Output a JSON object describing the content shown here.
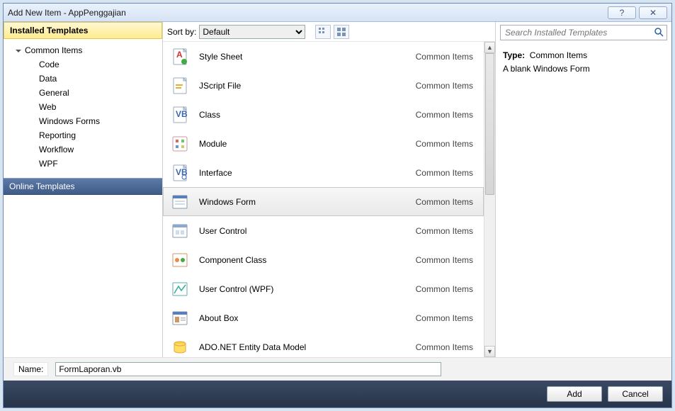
{
  "window": {
    "title": "Add New Item - AppPenggajian"
  },
  "sidebar": {
    "installed_header": "Installed Templates",
    "root": "Common Items",
    "children": [
      "Code",
      "Data",
      "General",
      "Web",
      "Windows Forms",
      "Reporting",
      "Workflow",
      "WPF"
    ],
    "online_header": "Online Templates"
  },
  "toolbar": {
    "sort_label": "Sort by:",
    "sort_value": "Default"
  },
  "items": [
    {
      "name": "Style Sheet",
      "cat": "Common Items",
      "icon": "stylesheet",
      "selected": false
    },
    {
      "name": "JScript File",
      "cat": "Common Items",
      "icon": "jscript",
      "selected": false
    },
    {
      "name": "Class",
      "cat": "Common Items",
      "icon": "class",
      "selected": false
    },
    {
      "name": "Module",
      "cat": "Common Items",
      "icon": "module",
      "selected": false
    },
    {
      "name": "Interface",
      "cat": "Common Items",
      "icon": "interface",
      "selected": false
    },
    {
      "name": "Windows Form",
      "cat": "Common Items",
      "icon": "form",
      "selected": true
    },
    {
      "name": "User Control",
      "cat": "Common Items",
      "icon": "usercontrol",
      "selected": false
    },
    {
      "name": "Component Class",
      "cat": "Common Items",
      "icon": "component",
      "selected": false
    },
    {
      "name": "User Control (WPF)",
      "cat": "Common Items",
      "icon": "wpfuc",
      "selected": false
    },
    {
      "name": "About Box",
      "cat": "Common Items",
      "icon": "about",
      "selected": false
    },
    {
      "name": "ADO.NET Entity Data Model",
      "cat": "Common Items",
      "icon": "ado",
      "selected": false
    }
  ],
  "search": {
    "placeholder": "Search Installed Templates"
  },
  "details": {
    "type_label": "Type:",
    "type_value": "Common Items",
    "description": "A blank Windows Form"
  },
  "namebar": {
    "label": "Name:",
    "value": "FormLaporan.vb"
  },
  "footer": {
    "add": "Add",
    "cancel": "Cancel"
  }
}
